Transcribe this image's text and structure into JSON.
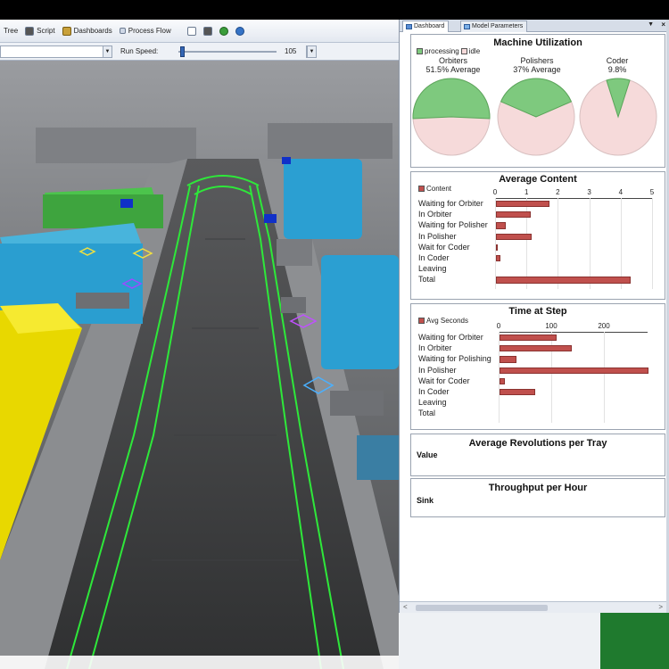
{
  "toolbar": {
    "items": [
      "Tree",
      "Script",
      "Dashboards",
      "Process Flow"
    ]
  },
  "speedbar": {
    "run_speed_label": "Run Speed:",
    "run_speed_value": "105",
    "run_speed_fraction": 0.02
  },
  "dashboard_panel": {
    "tabs": [
      "Dashboard",
      "Model Parameters"
    ],
    "menu_arrow": "▼",
    "close": "×",
    "scroll_left": "<",
    "scroll_right": ">"
  },
  "colors": {
    "processing": "#7ec97e",
    "idle": "#f6dada",
    "bar": "#c0504d"
  },
  "chart_data": [
    {
      "type": "pie",
      "title": "Machine Utilization",
      "legend": [
        "processing",
        "idle"
      ],
      "pies": [
        {
          "name": "Orbiters",
          "label": "51.5% Average",
          "value": 0.515
        },
        {
          "name": "Polishers",
          "label": "37% Average",
          "value": 0.37
        },
        {
          "name": "Coder",
          "label": "9.8%",
          "value": 0.098
        }
      ]
    },
    {
      "type": "bar",
      "title": "Average Content",
      "legend": [
        "Content"
      ],
      "categories": [
        "Waiting for Orbiter",
        "In Orbiter",
        "Waiting for Polisher",
        "In Polisher",
        "Wait for Coder",
        "In Coder",
        "Leaving",
        "Total"
      ],
      "values": [
        1.7,
        1.1,
        0.3,
        1.15,
        0.02,
        0.15,
        0,
        4.3
      ],
      "xlim": [
        0,
        5
      ],
      "xticks": [
        "0",
        "1",
        "2",
        "3",
        "4",
        "5"
      ]
    },
    {
      "type": "bar",
      "title": "Time at Step",
      "legend": [
        "Avg Seconds"
      ],
      "categories": [
        "Waiting for Orbiter",
        "In Orbiter",
        "Waiting for Polishing",
        "In Polisher",
        "Wait for Coder",
        "In Coder",
        "Leaving",
        "Total"
      ],
      "values": [
        108,
        137,
        32,
        283,
        10,
        67,
        0,
        0
      ],
      "xlim": [
        0,
        283
      ],
      "xticks": [
        "0",
        "100",
        "200"
      ]
    }
  ],
  "average_revolutions": {
    "title": "Average Revolutions per Tray",
    "row_label": "Value"
  },
  "throughput": {
    "title": "Throughput per Hour",
    "row_label": "Sink"
  }
}
